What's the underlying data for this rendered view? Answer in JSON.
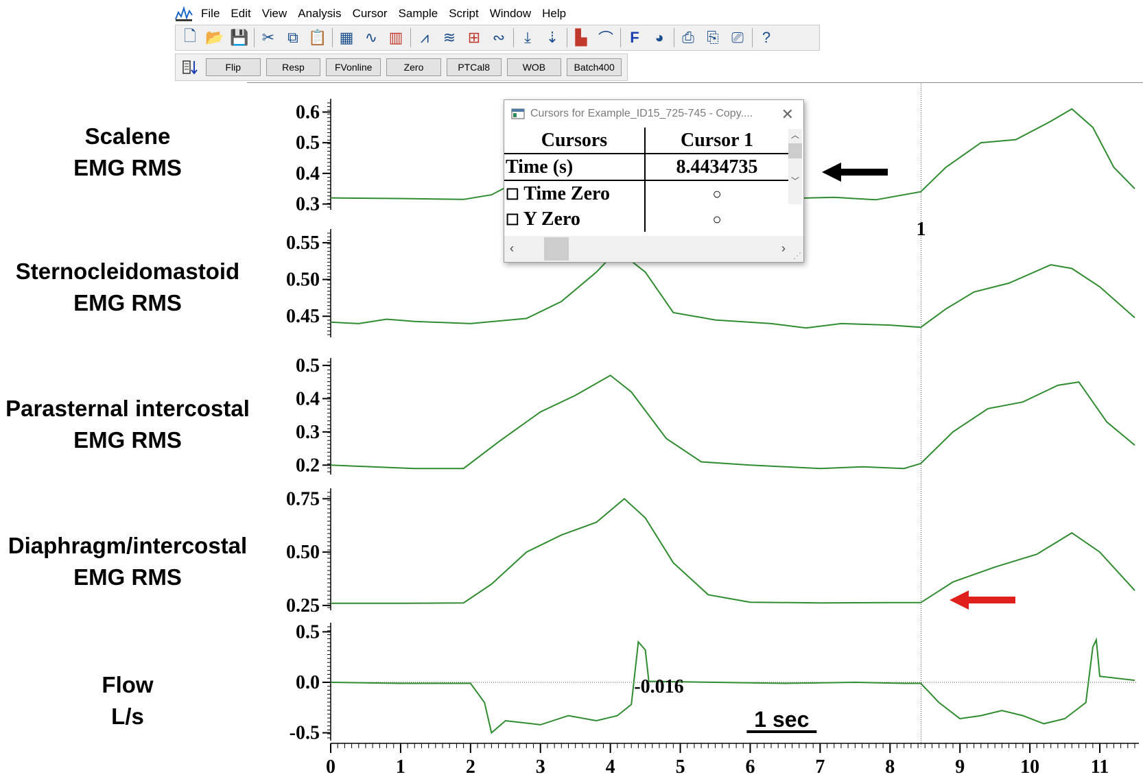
{
  "menu": [
    "File",
    "Edit",
    "View",
    "Analysis",
    "Cursor",
    "Sample",
    "Script",
    "Window",
    "Help"
  ],
  "toolbar_icons": [
    "new-file-icon",
    "open-folder-icon",
    "save-icon",
    "cut-icon",
    "copy-icon",
    "paste-icon",
    "clipboard-icon",
    "waveform-icon",
    "bar-graph-icon",
    "trace-icon",
    "signal-icon",
    "grid-icon",
    "sine-icon",
    "cursor-down-icon",
    "cursor-pair-icon",
    "histogram-icon",
    "curve-fit-icon",
    "function-icon",
    "palette-icon",
    "print-icon",
    "print-preview-icon",
    "print-selection-icon",
    "help-icon"
  ],
  "buttons": [
    "Flip",
    "Resp",
    "FVonline",
    "Zero",
    "PTCal8",
    "WOB",
    "Batch400"
  ],
  "channels": [
    {
      "label_line1": "Scalene",
      "label_line2": "EMG RMS"
    },
    {
      "label_line1": "Sternocleidomastoid",
      "label_line2": "EMG RMS"
    },
    {
      "label_line1": "Parasternal intercostal",
      "label_line2": "EMG RMS"
    },
    {
      "label_line1": "Diaphragm/intercostal",
      "label_line2": "EMG RMS"
    },
    {
      "label_line1": "Flow",
      "label_line2": "L/s"
    }
  ],
  "cursor_label": "1",
  "flow_value_label": "-0.016",
  "scale_bar_label": "1 sec",
  "dialog": {
    "title": "Cursors for Example_ID15_725-745 - Copy....",
    "header_col1": "Cursors",
    "header_col2": "Cursor 1",
    "time_label": "Time (s)",
    "time_value": "8.4434735",
    "row_time_zero": "Time Zero",
    "row_y_zero": "Y Zero"
  },
  "colors": {
    "trace": "#2e8b2e",
    "arrow_black": "#000000",
    "arrow_red": "#e0201c"
  },
  "chart_data": {
    "type": "line",
    "x_label": "",
    "x_range": [
      0,
      11.5
    ],
    "x_ticks": [
      "0",
      "1",
      "2",
      "3",
      "4",
      "5",
      "6",
      "7",
      "8",
      "9",
      "10",
      "11"
    ],
    "cursor_x": 8.4434735,
    "panels": [
      {
        "name": "Scalene EMG RMS",
        "y_range": [
          0.29,
          0.63
        ],
        "y_ticks": [
          "0.3",
          "0.4",
          "0.5",
          "0.6"
        ],
        "points": [
          [
            0,
            0.32
          ],
          [
            1,
            0.318
          ],
          [
            1.9,
            0.315
          ],
          [
            2.3,
            0.33
          ],
          [
            2.8,
            0.39
          ],
          [
            3.5,
            0.45
          ],
          [
            4.0,
            0.48
          ],
          [
            4.3,
            0.44
          ],
          [
            4.8,
            0.36
          ],
          [
            5.5,
            0.325
          ],
          [
            6.5,
            0.318
          ],
          [
            7.2,
            0.322
          ],
          [
            7.8,
            0.314
          ],
          [
            8.44,
            0.34
          ],
          [
            8.8,
            0.42
          ],
          [
            9.3,
            0.5
          ],
          [
            9.8,
            0.51
          ],
          [
            10.3,
            0.57
          ],
          [
            10.6,
            0.61
          ],
          [
            10.9,
            0.55
          ],
          [
            11.2,
            0.42
          ],
          [
            11.5,
            0.35
          ]
        ]
      },
      {
        "name": "Sternocleidomastoid EMG RMS",
        "y_range": [
          0.425,
          0.563
        ],
        "y_ticks": [
          "0.45",
          "0.50",
          "0.55"
        ],
        "points": [
          [
            0,
            0.442
          ],
          [
            0.4,
            0.44
          ],
          [
            0.8,
            0.446
          ],
          [
            1.2,
            0.443
          ],
          [
            2.0,
            0.44
          ],
          [
            2.8,
            0.447
          ],
          [
            3.3,
            0.47
          ],
          [
            3.8,
            0.51
          ],
          [
            4.1,
            0.54
          ],
          [
            4.5,
            0.51
          ],
          [
            4.9,
            0.455
          ],
          [
            5.5,
            0.445
          ],
          [
            6.3,
            0.44
          ],
          [
            6.8,
            0.434
          ],
          [
            7.3,
            0.44
          ],
          [
            8.0,
            0.438
          ],
          [
            8.44,
            0.435
          ],
          [
            8.8,
            0.46
          ],
          [
            9.2,
            0.483
          ],
          [
            9.7,
            0.495
          ],
          [
            10.3,
            0.52
          ],
          [
            10.6,
            0.515
          ],
          [
            11.0,
            0.49
          ],
          [
            11.5,
            0.448
          ]
        ]
      },
      {
        "name": "Parasternal intercostal EMG RMS",
        "y_range": [
          0.18,
          0.51
        ],
        "y_ticks": [
          "0.2",
          "0.3",
          "0.4",
          "0.5"
        ],
        "points": [
          [
            0,
            0.2
          ],
          [
            0.6,
            0.195
          ],
          [
            1.2,
            0.19
          ],
          [
            1.9,
            0.19
          ],
          [
            2.4,
            0.27
          ],
          [
            3.0,
            0.36
          ],
          [
            3.5,
            0.41
          ],
          [
            4.0,
            0.47
          ],
          [
            4.3,
            0.42
          ],
          [
            4.8,
            0.28
          ],
          [
            5.3,
            0.21
          ],
          [
            6.0,
            0.2
          ],
          [
            7.0,
            0.19
          ],
          [
            7.6,
            0.195
          ],
          [
            8.2,
            0.19
          ],
          [
            8.44,
            0.205
          ],
          [
            8.9,
            0.3
          ],
          [
            9.4,
            0.37
          ],
          [
            9.9,
            0.39
          ],
          [
            10.4,
            0.44
          ],
          [
            10.7,
            0.45
          ],
          [
            11.1,
            0.33
          ],
          [
            11.5,
            0.26
          ]
        ]
      },
      {
        "name": "Diaphragm/intercostal EMG RMS",
        "y_range": [
          0.24,
          0.78
        ],
        "y_ticks": [
          "0.25",
          "0.50",
          "0.75"
        ],
        "points": [
          [
            0,
            0.26
          ],
          [
            1,
            0.26
          ],
          [
            1.9,
            0.262
          ],
          [
            2.3,
            0.35
          ],
          [
            2.8,
            0.5
          ],
          [
            3.3,
            0.58
          ],
          [
            3.8,
            0.64
          ],
          [
            4.2,
            0.75
          ],
          [
            4.5,
            0.66
          ],
          [
            4.9,
            0.45
          ],
          [
            5.4,
            0.3
          ],
          [
            6.0,
            0.265
          ],
          [
            7.0,
            0.262
          ],
          [
            8.0,
            0.263
          ],
          [
            8.44,
            0.263
          ],
          [
            8.9,
            0.36
          ],
          [
            9.5,
            0.43
          ],
          [
            10.1,
            0.49
          ],
          [
            10.6,
            0.59
          ],
          [
            11.0,
            0.5
          ],
          [
            11.5,
            0.32
          ]
        ]
      },
      {
        "name": "Flow L/s",
        "y_range": [
          -0.55,
          0.55
        ],
        "y_ticks": [
          "-0.5",
          "0.0",
          "0.5"
        ],
        "points": [
          [
            0,
            0.0
          ],
          [
            1,
            -0.01
          ],
          [
            2.0,
            -0.01
          ],
          [
            2.2,
            -0.2
          ],
          [
            2.3,
            -0.5
          ],
          [
            2.5,
            -0.38
          ],
          [
            3.0,
            -0.42
          ],
          [
            3.4,
            -0.33
          ],
          [
            3.8,
            -0.38
          ],
          [
            4.1,
            -0.33
          ],
          [
            4.3,
            -0.22
          ],
          [
            4.4,
            0.4
          ],
          [
            4.5,
            0.32
          ],
          [
            4.55,
            0.01
          ],
          [
            5.5,
            0.0
          ],
          [
            6.5,
            -0.01
          ],
          [
            7.5,
            0.0
          ],
          [
            8.2,
            -0.01
          ],
          [
            8.44,
            -0.01
          ],
          [
            8.7,
            -0.2
          ],
          [
            9.0,
            -0.36
          ],
          [
            9.3,
            -0.33
          ],
          [
            9.6,
            -0.28
          ],
          [
            9.9,
            -0.33
          ],
          [
            10.2,
            -0.41
          ],
          [
            10.5,
            -0.36
          ],
          [
            10.8,
            -0.2
          ],
          [
            10.9,
            0.35
          ],
          [
            10.95,
            0.42
          ],
          [
            11.0,
            0.06
          ],
          [
            11.5,
            0.02
          ]
        ]
      }
    ]
  }
}
